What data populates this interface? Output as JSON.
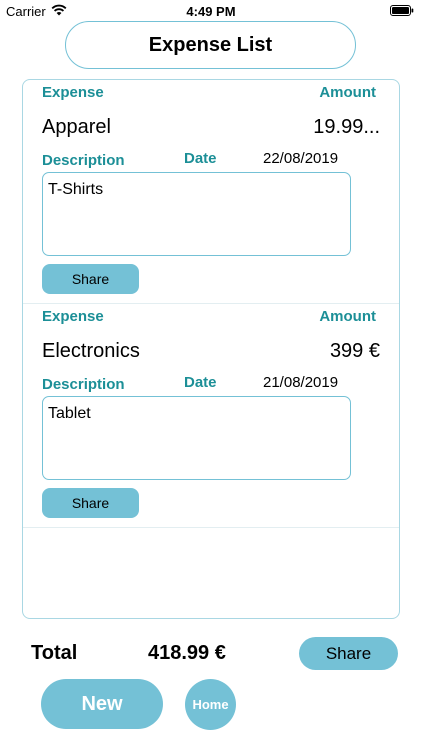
{
  "status_bar": {
    "carrier": "Carrier",
    "time": "4:49 PM",
    "wifi_icon": "wifi-icon",
    "battery_icon": "battery-icon"
  },
  "header": {
    "title": "Expense List"
  },
  "labels": {
    "expense": "Expense",
    "amount": "Amount",
    "description": "Description",
    "date": "Date",
    "share": "Share"
  },
  "expenses": [
    {
      "category": "Apparel",
      "amount": "19.99...",
      "date": "22/08/2019",
      "description": "T-Shirts"
    },
    {
      "category": "Electronics",
      "amount": "399 €",
      "date": "21/08/2019",
      "description": "Tablet"
    }
  ],
  "footer": {
    "total_label": "Total",
    "total_value": "418.99 €",
    "share_label": "Share",
    "new_label": "New",
    "home_label": "Home"
  },
  "colors": {
    "accent": "#74c1d6",
    "label_teal": "#1c8f97",
    "border_light": "#a9d7e3"
  }
}
